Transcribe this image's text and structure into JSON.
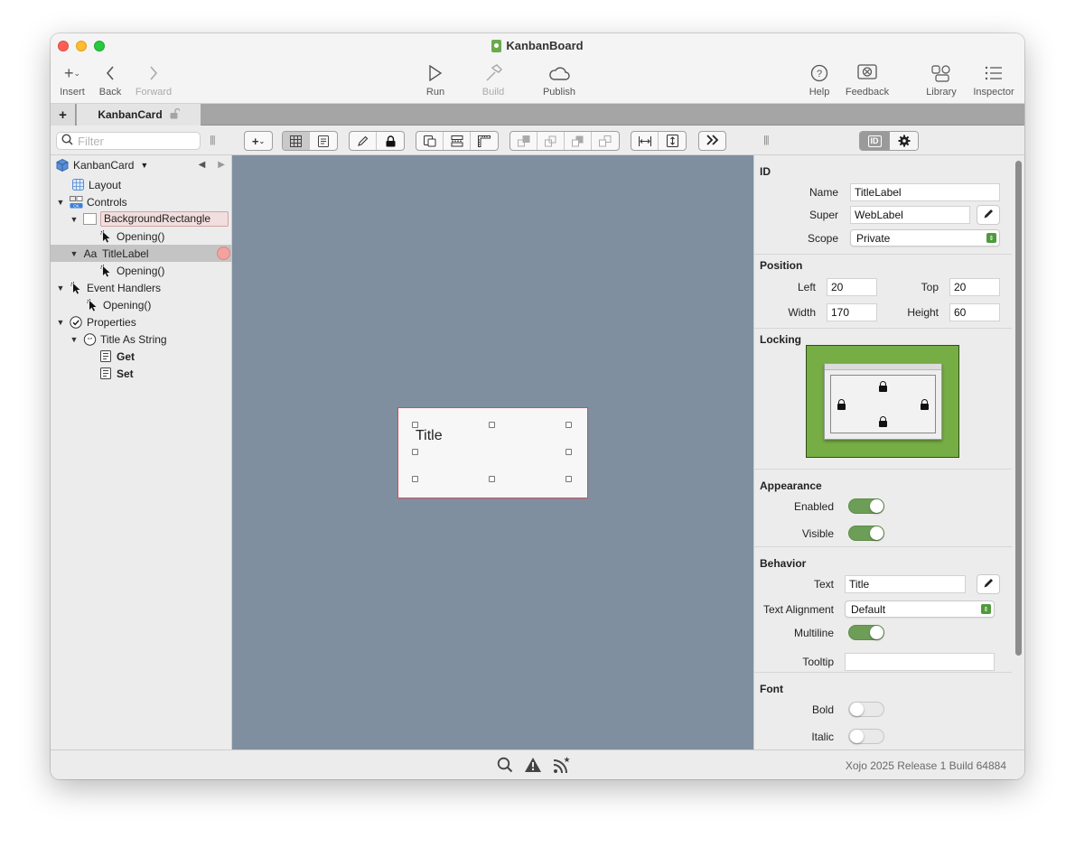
{
  "window": {
    "title": "KanbanBoard"
  },
  "toolbar": {
    "insert": "Insert",
    "back": "Back",
    "forward": "Forward",
    "run": "Run",
    "build": "Build",
    "publish": "Publish",
    "help": "Help",
    "feedback": "Feedback",
    "library": "Library",
    "inspector": "Inspector"
  },
  "tabs": {
    "add": "+",
    "active": "KanbanCard"
  },
  "filter": {
    "placeholder": "Filter"
  },
  "navigator": {
    "root": "KanbanCard",
    "items": [
      "Layout",
      "Controls",
      "BackgroundRectangle",
      "Opening()",
      "TitleLabel",
      "Opening()",
      "Event Handlers",
      "Opening()",
      "Properties",
      "Title As String",
      "Get",
      "Set"
    ]
  },
  "canvas": {
    "card_text": "Title"
  },
  "inspector": {
    "id_section": "ID",
    "name_label": "Name",
    "name_value": "TitleLabel",
    "super_label": "Super",
    "super_value": "WebLabel",
    "scope_label": "Scope",
    "scope_value": "Private",
    "position_section": "Position",
    "left_label": "Left",
    "left_value": "20",
    "top_label": "Top",
    "top_value": "20",
    "width_label": "Width",
    "width_value": "170",
    "height_label": "Height",
    "height_value": "60",
    "locking_section": "Locking",
    "appearance_section": "Appearance",
    "enabled_label": "Enabled",
    "visible_label": "Visible",
    "behavior_section": "Behavior",
    "text_label": "Text",
    "text_value": "Title",
    "alignment_label": "Text Alignment",
    "alignment_value": "Default",
    "multiline_label": "Multiline",
    "tooltip_label": "Tooltip",
    "tooltip_value": "",
    "font_section": "Font",
    "bold_label": "Bold",
    "italic_label": "Italic",
    "toggles": {
      "enabled": true,
      "visible": true,
      "multiline": true,
      "bold": false,
      "italic": false
    }
  },
  "status": {
    "version": "Xojo 2025 Release 1 Build 64884"
  },
  "colors": {
    "accent_green": "#6d9e57",
    "canvas": "#7f8f9f",
    "selection_red": "#d9485a"
  }
}
